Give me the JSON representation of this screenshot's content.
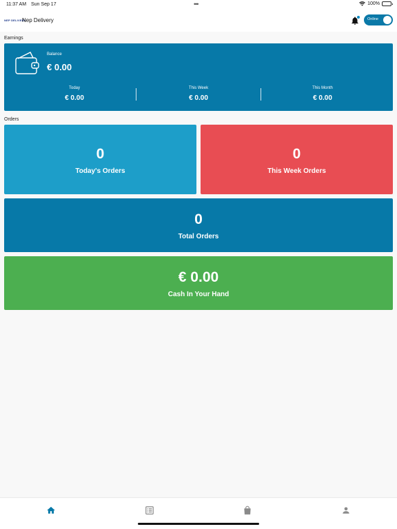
{
  "status_bar": {
    "time": "11:37 AM",
    "date": "Sun Sep 17",
    "battery": "100%"
  },
  "app_bar": {
    "logo_text": "NEP DELIVERY",
    "title": "Nep Delivery",
    "toggle_label": "Online"
  },
  "earnings": {
    "section_label": "Earnings",
    "balance_label": "Balance",
    "balance_value": "€ 0.00",
    "stats": [
      {
        "label": "Today",
        "value": "€ 0.00"
      },
      {
        "label": "This Week",
        "value": "€ 0.00"
      },
      {
        "label": "This Month",
        "value": "€ 0.00"
      }
    ]
  },
  "orders": {
    "section_label": "Orders",
    "today": {
      "value": "0",
      "label": "Today's Orders"
    },
    "week": {
      "value": "0",
      "label": "This Week Orders"
    },
    "total": {
      "value": "0",
      "label": "Total Orders"
    },
    "cash": {
      "value": "€ 0.00",
      "label": "Cash In Your Hand"
    }
  },
  "colors": {
    "primary": "#0779a8",
    "today_tile": "#1d9ec9",
    "week_tile": "#e84d53",
    "cash_tile": "#4caf50",
    "nav_active": "#0779a8",
    "nav_inactive": "#8a8a8a"
  },
  "nav": [
    "home-icon",
    "orders-list-icon",
    "shopping-bag-icon",
    "profile-icon"
  ]
}
